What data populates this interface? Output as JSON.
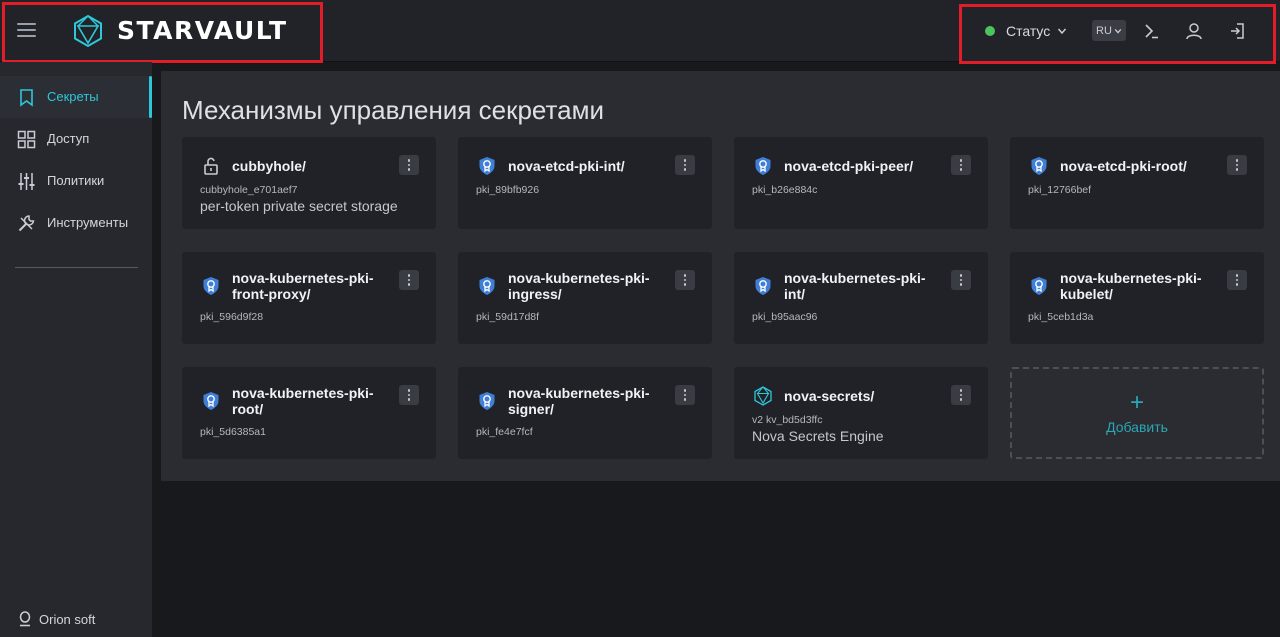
{
  "header": {
    "brand": "STARVAULT",
    "status_label": "Статус",
    "lang": "RU",
    "status_color": "#4cc35c",
    "icons": [
      "menu-icon",
      "logo-icon",
      "chevron-down-icon",
      "terminal-icon",
      "user-icon",
      "logout-icon"
    ]
  },
  "sidebar": {
    "items": [
      {
        "label": "Секреты",
        "icon": "bookmark-icon",
        "active": true
      },
      {
        "label": "Доступ",
        "icon": "grid-icon",
        "active": false
      },
      {
        "label": "Политики",
        "icon": "sliders-icon",
        "active": false
      },
      {
        "label": "Инструменты",
        "icon": "tools-icon",
        "active": false
      }
    ],
    "footer": "Orion soft",
    "accent": "#2fc7d8"
  },
  "main": {
    "title": "Механизмы управления секретами",
    "engines": [
      {
        "title": "cubbyhole/",
        "id": "cubbyhole_e701aef7",
        "desc": "per-token private secret storage",
        "icon": "lock-icon"
      },
      {
        "title": "nova-etcd-pki-int/",
        "id": "pki_89bfb926",
        "desc": "",
        "icon": "certificate-icon"
      },
      {
        "title": "nova-etcd-pki-peer/",
        "id": "pki_b26e884c",
        "desc": "",
        "icon": "certificate-icon"
      },
      {
        "title": "nova-etcd-pki-root/",
        "id": "pki_12766bef",
        "desc": "",
        "icon": "certificate-icon"
      },
      {
        "title": "nova-kubernetes-pki-front-proxy/",
        "id": "pki_596d9f28",
        "desc": "",
        "icon": "certificate-icon"
      },
      {
        "title": "nova-kubernetes-pki-ingress/",
        "id": "pki_59d17d8f",
        "desc": "",
        "icon": "certificate-icon"
      },
      {
        "title": "nova-kubernetes-pki-int/",
        "id": "pki_b95aac96",
        "desc": "",
        "icon": "certificate-icon"
      },
      {
        "title": "nova-kubernetes-pki-kubelet/",
        "id": "pki_5ceb1d3a",
        "desc": "",
        "icon": "certificate-icon"
      },
      {
        "title": "nova-kubernetes-pki-root/",
        "id": "pki_5d6385a1",
        "desc": "",
        "icon": "certificate-icon"
      },
      {
        "title": "nova-kubernetes-pki-signer/",
        "id": "pki_fe4e7fcf",
        "desc": "",
        "icon": "certificate-icon"
      },
      {
        "title": "nova-secrets/",
        "id": "v2 kv_bd5d3ffc",
        "desc": "Nova Secrets Engine",
        "icon": "hexagon-icon"
      }
    ],
    "add_label": "Добавить",
    "add_symbol": "+"
  }
}
